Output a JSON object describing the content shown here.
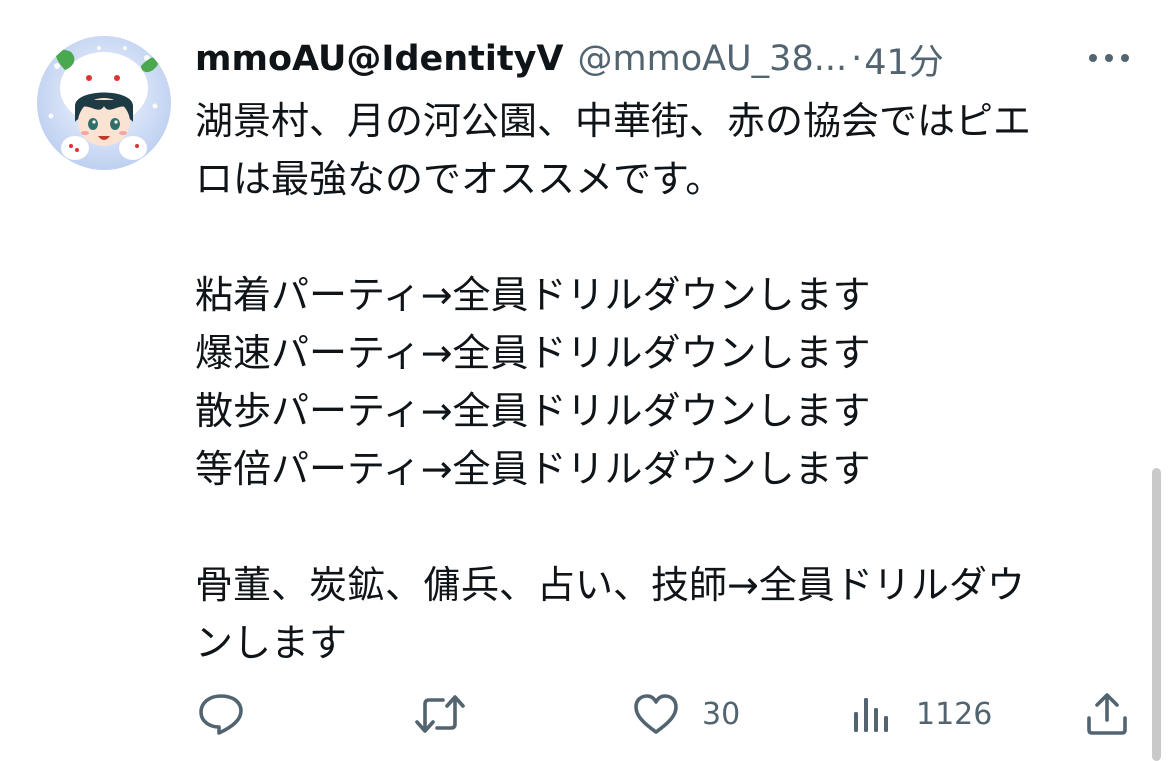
{
  "tweet": {
    "display_name": "mmoAU@IdentityV",
    "handle": "@mmoAU_38...",
    "separator": "·",
    "time": "41分",
    "lines": [
      "湖景村、月の河公園、中華街、赤の協会ではピエ",
      "ロは最強なのでオススメです。",
      "",
      "粘着パーティ→全員ドリルダウンします",
      "爆速パーティ→全員ドリルダウンします",
      "散歩パーティ→全員ドリルダウンします",
      "等倍パーティ→全員ドリルダウンします",
      "",
      "骨董、炭鉱、傭兵、占い、技師→全員ドリルダウ",
      "ンします"
    ]
  },
  "actions": {
    "reply": {
      "icon": "reply-icon",
      "count": ""
    },
    "retweet": {
      "icon": "retweet-icon",
      "count": ""
    },
    "like": {
      "icon": "heart-icon",
      "count": "30"
    },
    "views": {
      "icon": "views-icon",
      "count": "1126"
    },
    "share": {
      "icon": "share-icon"
    }
  },
  "colors": {
    "text": "#0f1419",
    "secondary": "#536471",
    "background": "#ffffff"
  }
}
